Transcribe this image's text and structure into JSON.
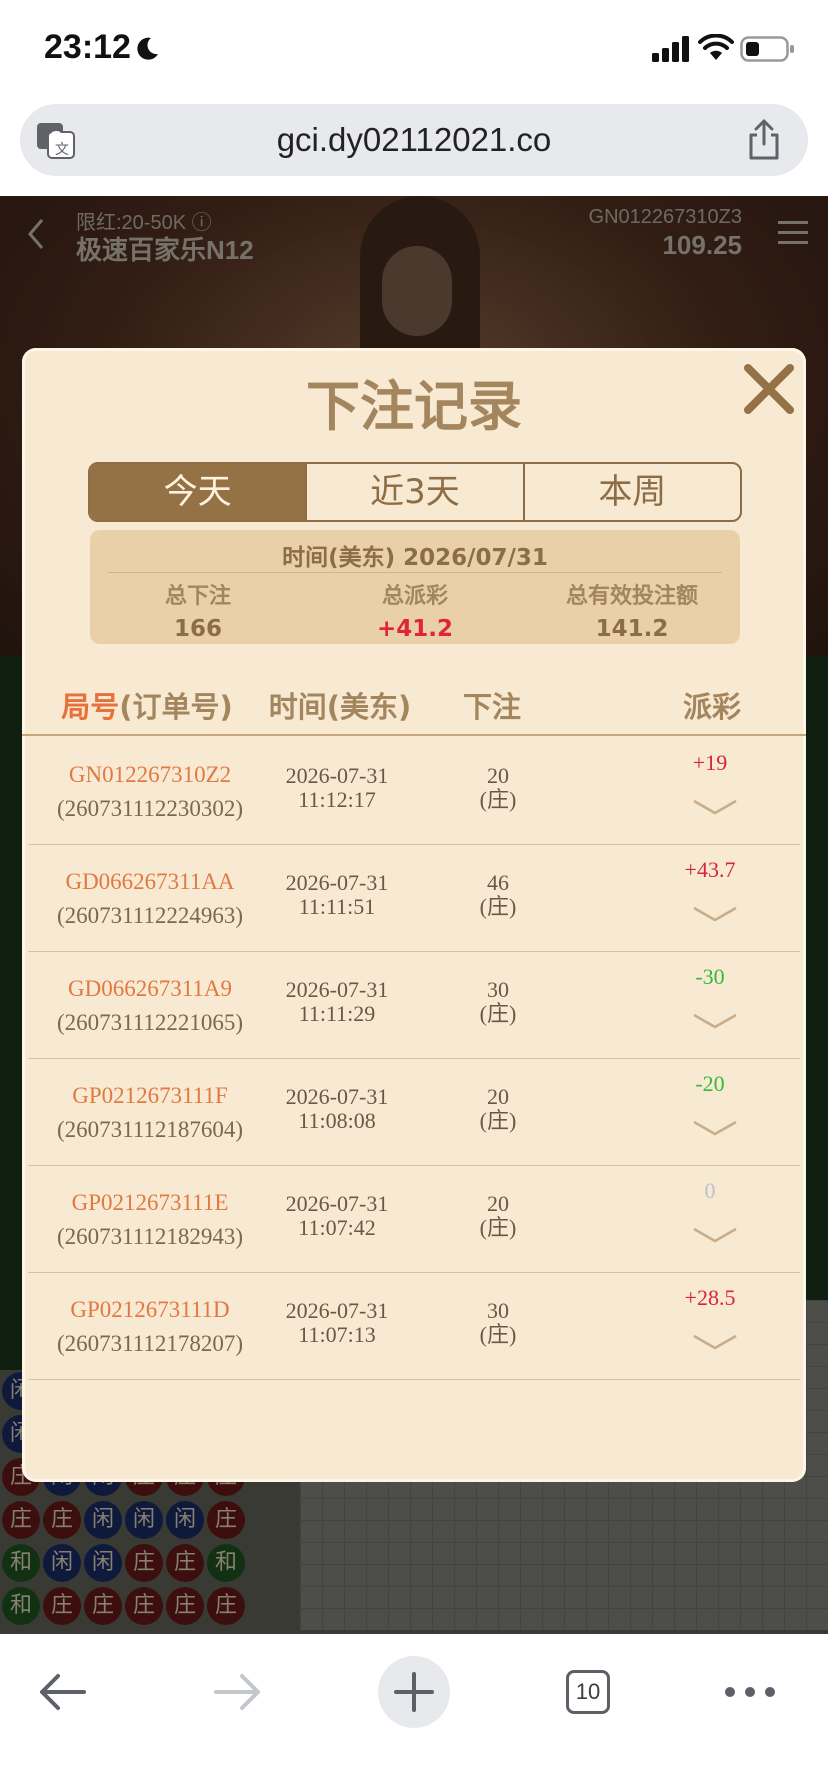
{
  "status_bar": {
    "time": "23:12"
  },
  "browser": {
    "url": "gci.dy02112021.co",
    "tab_count": "10"
  },
  "game": {
    "limit": "限红:20-50K ⓘ",
    "name": "极速百家乐N12",
    "round_code": "GN012267310Z3",
    "balance": "109.25",
    "beads": [
      [
        "闲",
        "闲",
        "庄",
        "庄",
        "和",
        "和"
      ],
      [
        "",
        "",
        "闲",
        "庄",
        "闲",
        "庄"
      ],
      [
        "",
        "",
        "闲",
        "闲",
        "闲",
        "庄"
      ],
      [
        "",
        "",
        "庄",
        "闲",
        "庄",
        "庄"
      ],
      [
        "",
        "",
        "庄",
        "闲",
        "庄",
        "庄"
      ],
      [
        "",
        "",
        "庄",
        "庄",
        "和",
        "庄"
      ]
    ]
  },
  "modal": {
    "title": "下注记录",
    "tabs": [
      "今天",
      "近3天",
      "本周"
    ],
    "active_tab": 0,
    "summary": {
      "date_line": "时间(美东) 2026/07/31",
      "total_bet_label": "总下注",
      "total_bet": "166",
      "total_payout_label": "总派彩",
      "total_payout": "+41.2",
      "valid_bet_label": "总有效投注额",
      "valid_bet": "141.2"
    },
    "columns": {
      "order_accent": "局号",
      "order_rest": "(订单号)",
      "time": "时间(美东)",
      "bet": "下注",
      "payout": "派彩"
    },
    "records": [
      {
        "round": "GN012267310Z2",
        "order": "(260731112230302)",
        "date": "2026-07-31",
        "time": "11:12:17",
        "amount": "20",
        "side": "(庄)",
        "payout": "+19",
        "payout_type": "pos"
      },
      {
        "round": "GD066267311AA",
        "order": "(260731112224963)",
        "date": "2026-07-31",
        "time": "11:11:51",
        "amount": "46",
        "side": "(庄)",
        "payout": "+43.7",
        "payout_type": "pos"
      },
      {
        "round": "GD066267311A9",
        "order": "(260731112221065)",
        "date": "2026-07-31",
        "time": "11:11:29",
        "amount": "30",
        "side": "(庄)",
        "payout": "-30",
        "payout_type": "neg"
      },
      {
        "round": "GP0212673111F",
        "order": "(260731112187604)",
        "date": "2026-07-31",
        "time": "11:08:08",
        "amount": "20",
        "side": "(庄)",
        "payout": "-20",
        "payout_type": "neg"
      },
      {
        "round": "GP0212673111E",
        "order": "(260731112182943)",
        "date": "2026-07-31",
        "time": "11:07:42",
        "amount": "20",
        "side": "(庄)",
        "payout": "0",
        "payout_type": "zero"
      },
      {
        "round": "GP0212673111D",
        "order": "(260731112178207)",
        "date": "2026-07-31",
        "time": "11:07:13",
        "amount": "30",
        "side": "(庄)",
        "payout": "+28.5",
        "payout_type": "pos"
      }
    ]
  },
  "icons": {
    "moon": "moon-icon",
    "signal": "cellular-signal-icon",
    "wifi": "wifi-icon",
    "battery": "battery-icon",
    "translate": "translate-icon",
    "share": "share-icon",
    "close": "close-icon",
    "chevron": "chevron-down-icon",
    "back": "back-arrow-icon",
    "forward": "forward-arrow-icon",
    "new_tab": "plus-icon",
    "more": "more-dots-icon"
  },
  "colors": {
    "accent": "#957146",
    "positive": "#d8253a",
    "negative": "#36b83a",
    "zero": "#b7c3cf",
    "order_text": "#e07a42"
  }
}
